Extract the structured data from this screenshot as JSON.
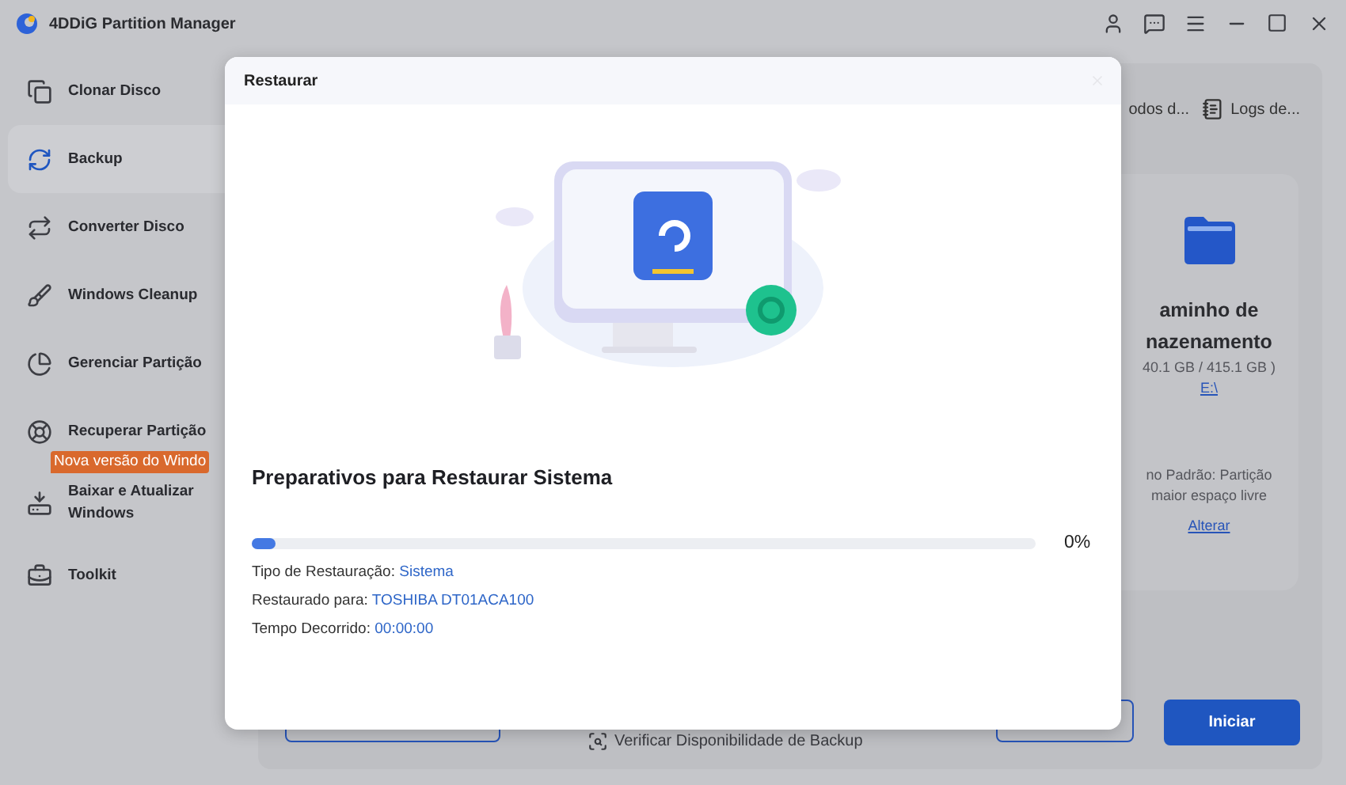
{
  "window": {
    "title": "4DDiG Partition Manager"
  },
  "sidebar": {
    "items": [
      {
        "label": "Clonar Disco",
        "selected": false
      },
      {
        "label": "Backup",
        "selected": true
      },
      {
        "label": "Converter Disco",
        "selected": false
      },
      {
        "label": "Windows Cleanup",
        "selected": false
      },
      {
        "label": "Gerenciar Partição",
        "selected": false
      },
      {
        "label": "Recuperar Partição",
        "selected": false
      },
      {
        "label": "Baixar e Atualizar Windows",
        "selected": false,
        "badge": "Nova versão do Windo"
      },
      {
        "label": "Toolkit",
        "selected": false
      }
    ]
  },
  "toolbar": {
    "links": [
      "odos d...",
      "Logs de..."
    ]
  },
  "storage_card": {
    "title_lines": [
      "aminho de",
      "nazenamento"
    ],
    "capacity": "40.1 GB / 415.1 GB )",
    "path": "E:\\",
    "note_lines": [
      "no Padrão: Partição",
      "maior espaço livre"
    ],
    "change_link": "Alterar"
  },
  "footer": {
    "check_link": "Verificar Disponibilidade de Backup",
    "start_button": "Iniciar"
  },
  "dialog": {
    "title": "Restaurar",
    "heading": "Preparativos para Restaurar Sistema",
    "progress": {
      "level": 0.03,
      "reading": "0%"
    },
    "details": [
      {
        "label": "Tipo de Restauração:",
        "value": "Sistema"
      },
      {
        "label": "Restaurado para:",
        "value": "TOSHIBA DT01ACA100"
      },
      {
        "label": "Tempo Decorrido:",
        "value": "00:00:00"
      }
    ]
  }
}
